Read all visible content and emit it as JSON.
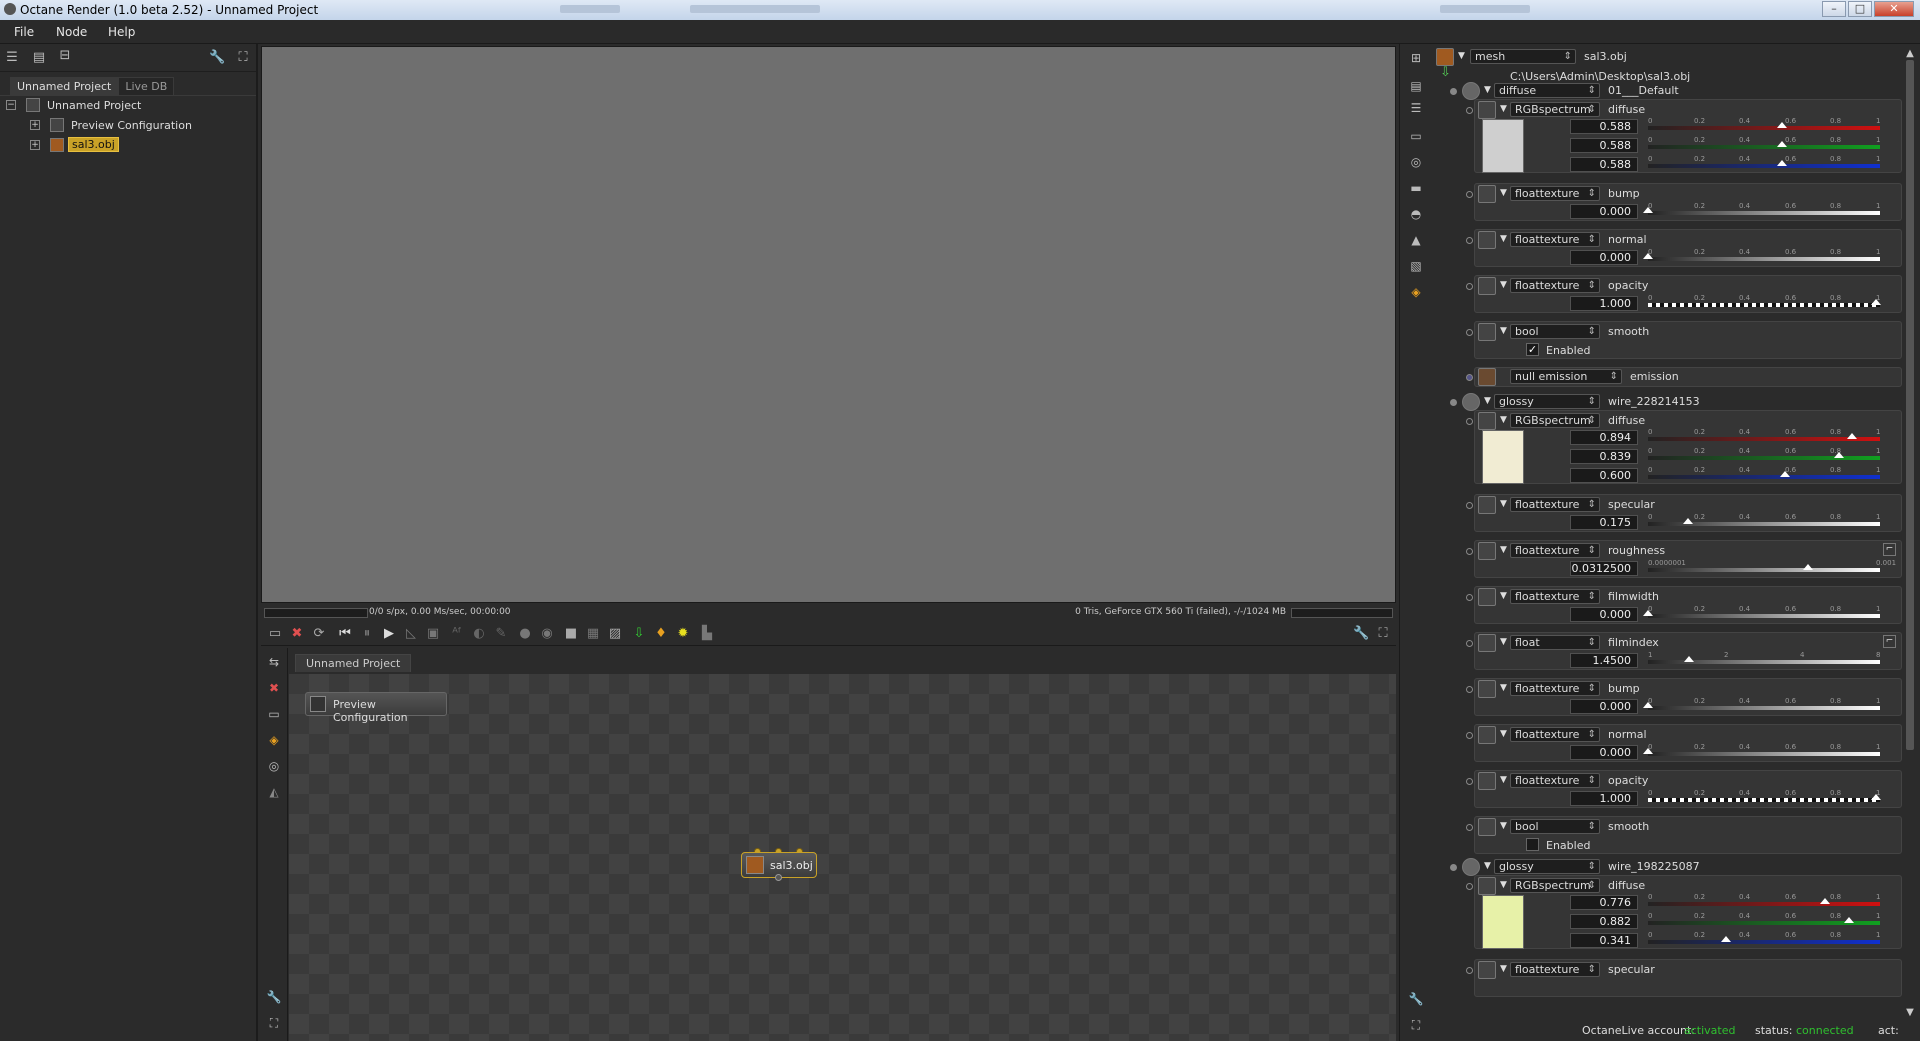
{
  "window": {
    "title": "Octane Render (1.0 beta 2.52) - Unnamed Project",
    "min": "–",
    "max": "□",
    "close": "✕"
  },
  "menu": [
    "File",
    "Node",
    "Help"
  ],
  "left": {
    "tabs": [
      "Unnamed Project",
      "Live DB"
    ],
    "tree": [
      "Unnamed Project",
      "Preview Configuration",
      "sal3.obj"
    ]
  },
  "render_status": {
    "left": "0/0 s/px, 0.00 Ms/sec, 00:00:00",
    "right": "0 Tris, GeForce GTX 560 Ti (failed), -/-/1024 MB"
  },
  "node_editor": {
    "tab": "Unnamed Project",
    "nodes": [
      "Preview Configuration",
      "sal3.obj"
    ]
  },
  "inspector": {
    "mesh_type": "mesh",
    "mesh_name": "sal3.obj",
    "file_path": "C:\\Users\\Admin\\Desktop\\sal3.obj",
    "materials": [
      {
        "type": "diffuse",
        "name": "01___Default",
        "diffuse": {
          "type": "RGBspectrum",
          "label": "diffuse",
          "rgb": [
            0.588,
            0.588,
            0.588
          ],
          "color": "#cfcfcf"
        }
      },
      {
        "type": "glossy",
        "name": "wire_228214153",
        "diffuse": {
          "type": "RGBspectrum",
          "label": "diffuse",
          "rgb": [
            0.894,
            0.839,
            0.6
          ],
          "color": "#f1ecd3"
        }
      },
      {
        "type": "glossy",
        "name": "wire_198225087",
        "diffuse": {
          "type": "RGBspectrum",
          "label": "diffuse",
          "rgb": [
            0.776,
            0.882,
            0.341
          ],
          "color": "#e7f1a8"
        }
      }
    ],
    "m1_params": [
      {
        "type": "floattexture",
        "label": "bump",
        "value": "0.000",
        "frac": 0.0
      },
      {
        "type": "floattexture",
        "label": "normal",
        "value": "0.000",
        "frac": 0.0
      },
      {
        "type": "floattexture",
        "label": "opacity",
        "value": "1.000",
        "frac": 1.0,
        "checker": true
      },
      {
        "type": "bool",
        "label": "smooth",
        "check_label": "Enabled",
        "checked": true
      },
      {
        "type": "null emission",
        "label": "emission"
      }
    ],
    "m2_params": [
      {
        "type": "floattexture",
        "label": "specular",
        "value": "0.175",
        "frac": 0.175
      },
      {
        "type": "floattexture",
        "label": "roughness",
        "value": "0.0312500",
        "frac": 0.7,
        "ticks": [
          "0.0000001",
          "0.001"
        ]
      },
      {
        "type": "floattexture",
        "label": "filmwidth",
        "value": "0.000",
        "frac": 0.0
      },
      {
        "type": "float",
        "label": "filmindex",
        "value": "1.4500",
        "frac": 0.18,
        "ticks": [
          "1",
          "2",
          "4",
          "8"
        ]
      },
      {
        "type": "floattexture",
        "label": "bump",
        "value": "0.000",
        "frac": 0.0
      },
      {
        "type": "floattexture",
        "label": "normal",
        "value": "0.000",
        "frac": 0.0
      },
      {
        "type": "floattexture",
        "label": "opacity",
        "value": "1.000",
        "frac": 1.0,
        "checker": true
      },
      {
        "type": "bool",
        "label": "smooth",
        "check_label": "Enabled",
        "checked": false
      }
    ],
    "m3_params": [
      {
        "type": "floattexture",
        "label": "specular"
      }
    ],
    "ticks": [
      "0",
      "0.2",
      "0.4",
      "0.6",
      "0.8",
      "1"
    ]
  },
  "footer": {
    "account_label": "OctaneLive account:",
    "account_value": "activated",
    "status_label": "status:",
    "status_value": "connected",
    "act_label": "act:"
  },
  "colors": {
    "red": "#d01010",
    "green": "#10a020",
    "blue": "#1030d0",
    "selection": "#c9a227",
    "active_text": "#2fc02f"
  }
}
